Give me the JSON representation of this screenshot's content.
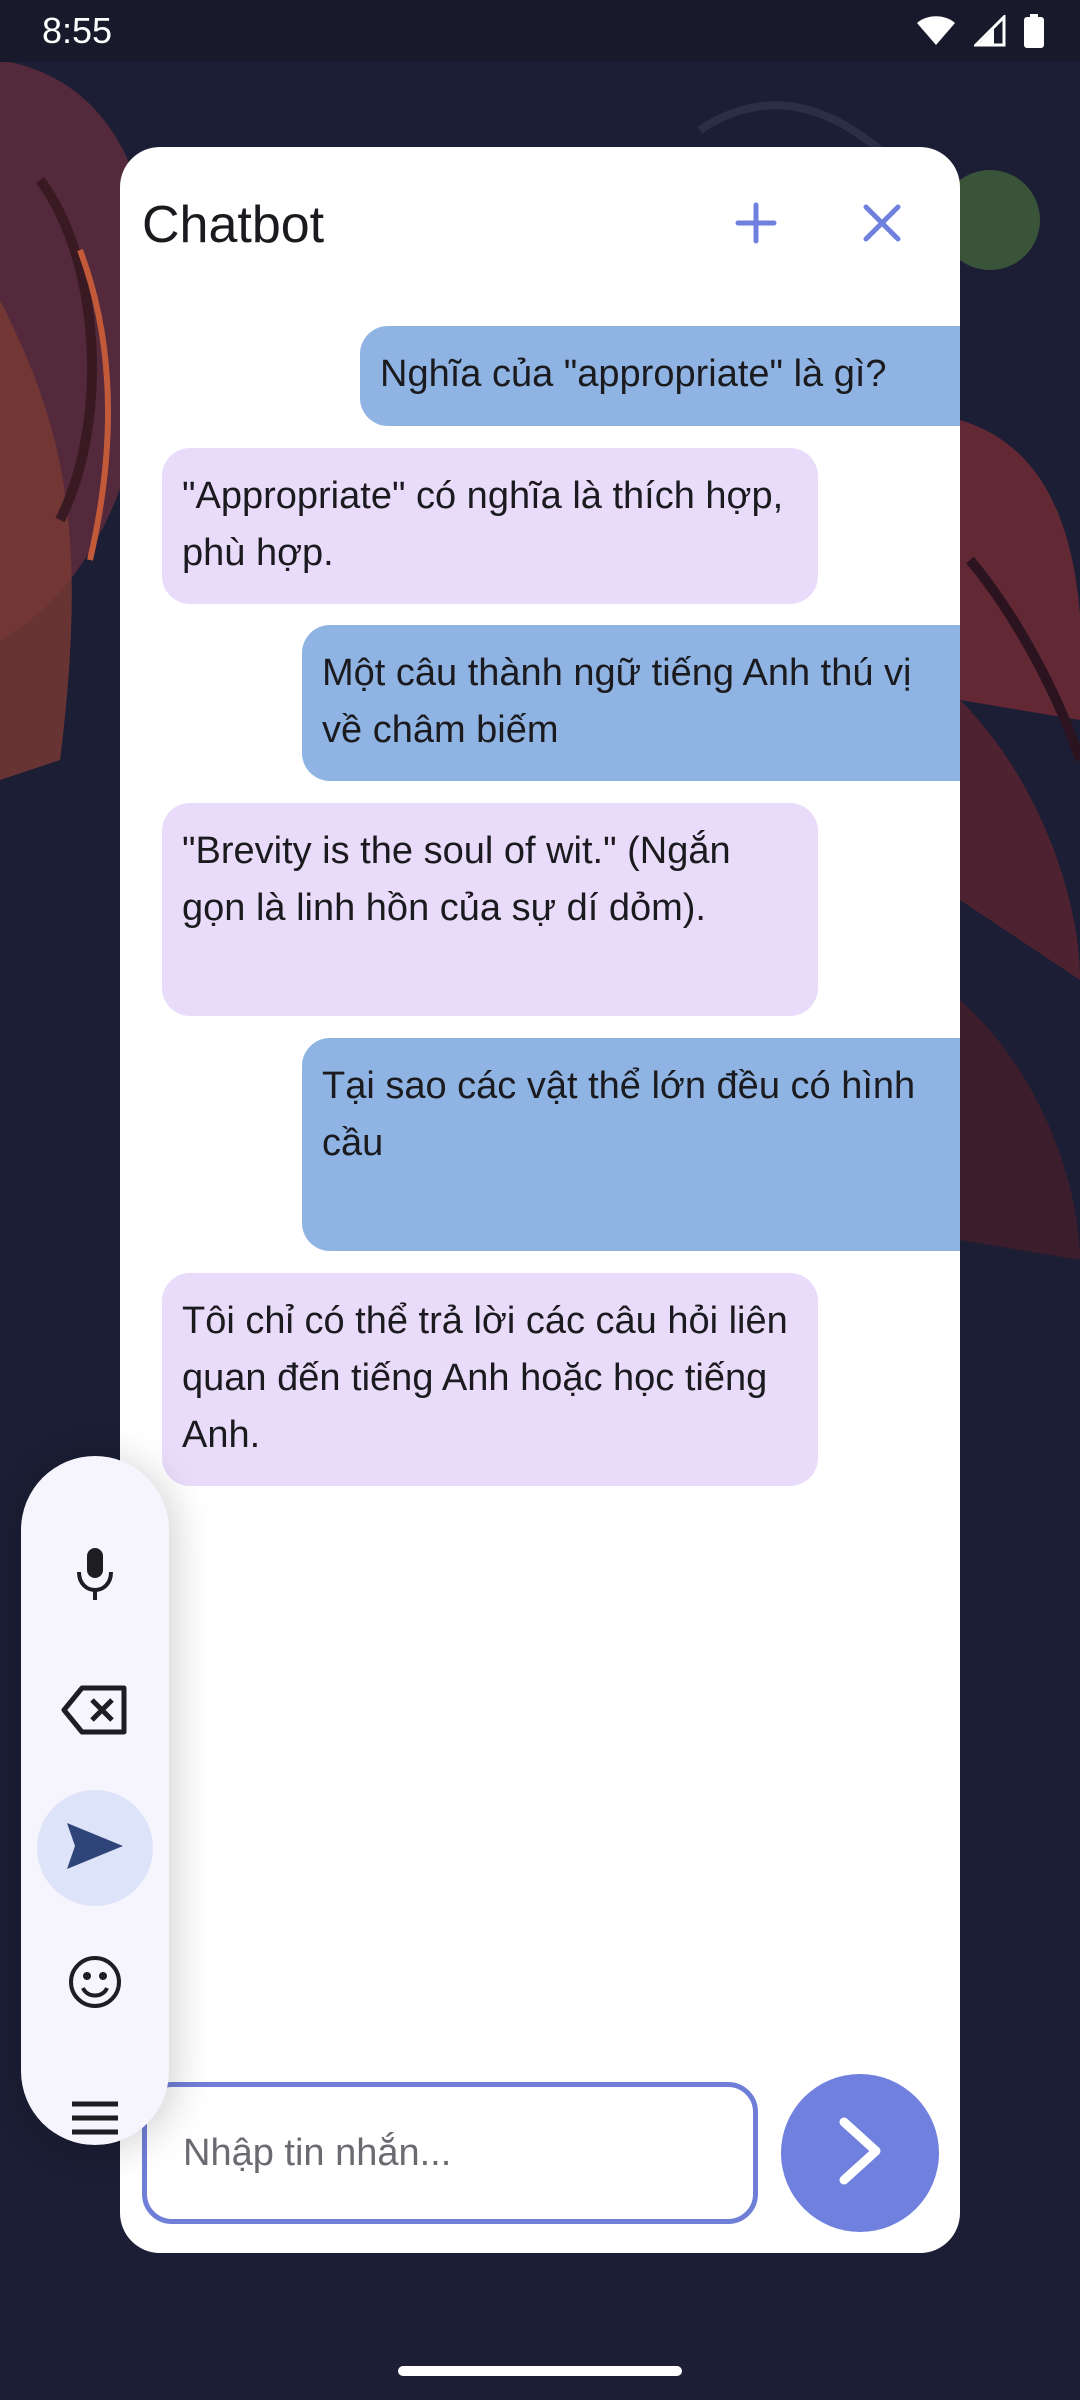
{
  "status_bar": {
    "time": "8:55",
    "icons": [
      "wifi-icon",
      "signal-icon",
      "battery-icon"
    ]
  },
  "chat": {
    "title": "Chatbot",
    "header_icons": [
      "add-icon",
      "close-icon"
    ],
    "messages": [
      {
        "role": "user",
        "text": "Nghĩa của \"appropriate\" là gì?"
      },
      {
        "role": "bot",
        "text": "\"Appropriate\" có nghĩa là thích hợp, phù hợp."
      },
      {
        "role": "user",
        "text": "Một câu thành ngữ tiếng Anh thú vị về châm biếm"
      },
      {
        "role": "bot",
        "text": "\"Brevity is the soul of wit.\" (Ngắn gọn là linh hồn của sự dí dỏm)."
      },
      {
        "role": "user",
        "text": "Tại sao các vật thể lớn đều có hình cầu"
      },
      {
        "role": "bot",
        "text": "Tôi chỉ có thể trả lời các câu hỏi liên quan đến tiếng Anh hoặc học tiếng Anh."
      }
    ],
    "input": {
      "placeholder": "Nhập tin nhắn..."
    }
  },
  "toolbar": {
    "tools": [
      "microphone-icon",
      "backspace-icon",
      "send-icon",
      "emoji-icon",
      "menu-icon"
    ],
    "active": "send-icon"
  },
  "colors": {
    "accent": "#6f80de",
    "user_bubble": "#8fb4e3",
    "bot_bubble": "#e9dcfb"
  }
}
